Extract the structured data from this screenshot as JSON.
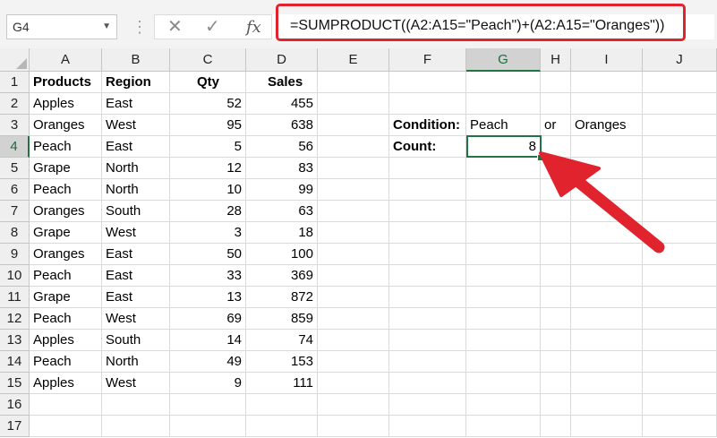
{
  "name_box": "G4",
  "formula": "=SUMPRODUCT((A2:A15=\"Peach\")+(A2:A15=\"Oranges\"))",
  "fx_label": "fx",
  "cancel_icon": "✕",
  "enter_icon": "✓",
  "columns": [
    "A",
    "B",
    "C",
    "D",
    "E",
    "F",
    "G",
    "H",
    "I",
    "J"
  ],
  "rows": [
    "1",
    "2",
    "3",
    "4",
    "5",
    "6",
    "7",
    "8",
    "9",
    "10",
    "11",
    "12",
    "13",
    "14",
    "15",
    "16",
    "17"
  ],
  "headers": {
    "products": "Products",
    "region": "Region",
    "qty": "Qty",
    "sales": "Sales"
  },
  "data": [
    {
      "product": "Apples",
      "region": "East",
      "qty": "52",
      "sales": "455"
    },
    {
      "product": "Oranges",
      "region": "West",
      "qty": "95",
      "sales": "638"
    },
    {
      "product": "Peach",
      "region": "East",
      "qty": "5",
      "sales": "56"
    },
    {
      "product": "Grape",
      "region": "North",
      "qty": "12",
      "sales": "83"
    },
    {
      "product": "Peach",
      "region": "North",
      "qty": "10",
      "sales": "99"
    },
    {
      "product": "Oranges",
      "region": "South",
      "qty": "28",
      "sales": "63"
    },
    {
      "product": "Grape",
      "region": "West",
      "qty": "3",
      "sales": "18"
    },
    {
      "product": "Oranges",
      "region": "East",
      "qty": "50",
      "sales": "100"
    },
    {
      "product": "Peach",
      "region": "East",
      "qty": "33",
      "sales": "369"
    },
    {
      "product": "Grape",
      "region": "East",
      "qty": "13",
      "sales": "872"
    },
    {
      "product": "Peach",
      "region": "West",
      "qty": "69",
      "sales": "859"
    },
    {
      "product": "Apples",
      "region": "South",
      "qty": "14",
      "sales": "74"
    },
    {
      "product": "Peach",
      "region": "North",
      "qty": "49",
      "sales": "153"
    },
    {
      "product": "Apples",
      "region": "West",
      "qty": "9",
      "sales": "111"
    }
  ],
  "condition": {
    "label": "Condition:",
    "value1": "Peach",
    "or": "or",
    "value2": "Oranges"
  },
  "count": {
    "label": "Count:",
    "value": "8"
  },
  "selected_cell": "G4",
  "colors": {
    "accent": "#217346",
    "highlight": "#e0232d"
  }
}
